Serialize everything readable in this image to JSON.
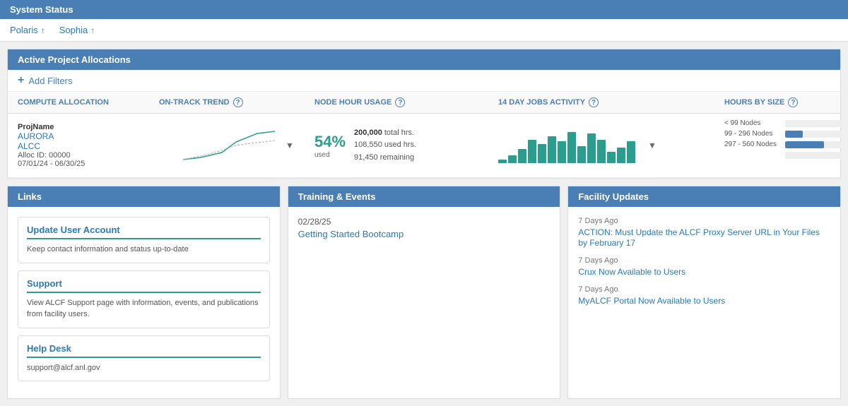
{
  "systemStatus": {
    "title": "System Status",
    "links": [
      {
        "name": "Polaris",
        "status": "up",
        "arrow": "↑"
      },
      {
        "name": "Sophia",
        "status": "up",
        "arrow": "↑"
      }
    ]
  },
  "allocations": {
    "sectionTitle": "Active Project Allocations",
    "filterLabel": "Add Filters",
    "columns": [
      {
        "label": "COMPUTE ALLOCATION",
        "helpIcon": false
      },
      {
        "label": "ON-TRACK TREND",
        "helpIcon": true
      },
      {
        "label": "NODE HOUR USAGE",
        "helpIcon": true
      },
      {
        "label": "14 DAY JOBS ACTIVITY",
        "helpIcon": true
      },
      {
        "label": "HOURS BY SIZE",
        "helpIcon": true
      }
    ],
    "row": {
      "projNameLabel": "ProjName",
      "proj1": "AURORA",
      "proj2": "ALCC",
      "allocId": "Alloc ID: 00000",
      "dateRange": "07/01/24 - 06/30/25",
      "usedPct": "54%",
      "usedLabel": "used",
      "totalHrsLabel": "total hrs.",
      "usedHrsLabel": "used hrs.",
      "remainingLabel": "remaining",
      "totalHrs": "200,000",
      "usedHrs": "108,550",
      "remaining": "91,450",
      "bars": [
        5,
        10,
        18,
        30,
        25,
        35,
        28,
        40,
        22,
        38,
        30,
        15,
        20,
        28
      ],
      "sizes": [
        {
          "label": "< 99 Nodes",
          "pct": 0,
          "pctLabel": ""
        },
        {
          "label": "99 - 296 Nodes",
          "pct": 31,
          "pctLabel": "31%"
        },
        {
          "label": "297 - 560 Nodes",
          "pct": 69,
          "pctLabel": "69%"
        },
        {
          "label": "",
          "pct": 0,
          "pctLabel": "0%"
        }
      ]
    }
  },
  "links": {
    "panelTitle": "Links",
    "cards": [
      {
        "title": "Update User Account",
        "desc": "Keep contact information and status up-to-date"
      },
      {
        "title": "Support",
        "desc": "View ALCF Support page with information, events, and publications from facility users."
      },
      {
        "title": "Help Desk",
        "desc": "support@alcf.anl.gov"
      }
    ]
  },
  "training": {
    "panelTitle": "Training & Events",
    "items": [
      {
        "date": "02/28/25",
        "title": "Getting Started Bootcamp"
      }
    ]
  },
  "facility": {
    "panelTitle": "Facility Updates",
    "items": [
      {
        "ago": "7 Days Ago",
        "title": "ACTION: Must Update the ALCF Proxy Server URL in Your Files by February 17"
      },
      {
        "ago": "7 Days Ago",
        "title": "Crux Now Available to Users"
      },
      {
        "ago": "7 Days Ago",
        "title": "MyALCF Portal Now Available to Users"
      }
    ]
  }
}
